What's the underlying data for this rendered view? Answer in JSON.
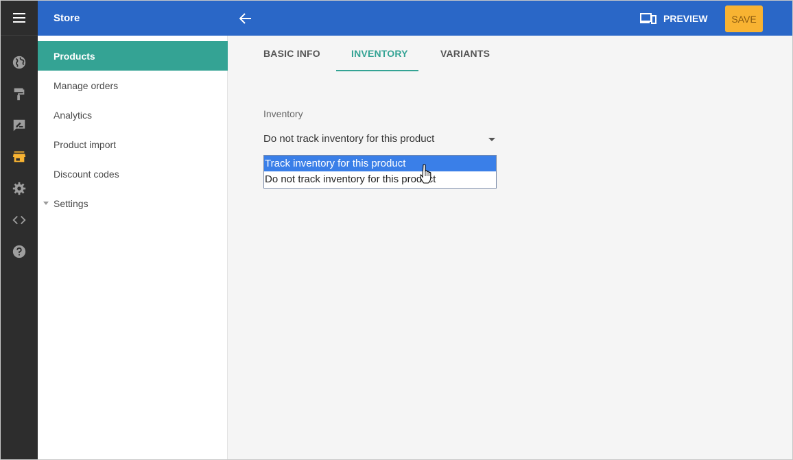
{
  "app": {
    "title": "Store"
  },
  "rail": {
    "icons": [
      "menu-icon",
      "globe-icon",
      "paint-roller-icon",
      "feedback-icon",
      "store-icon",
      "gear-icon",
      "code-icon",
      "help-icon"
    ],
    "active_color": "#f8b332"
  },
  "header": {
    "back_icon": "arrow-left-icon",
    "preview_label": "PREVIEW",
    "save_label": "SAVE"
  },
  "sidebar": {
    "items": [
      {
        "label": "Products",
        "active": true
      },
      {
        "label": "Manage orders"
      },
      {
        "label": "Analytics"
      },
      {
        "label": "Product import"
      },
      {
        "label": "Discount codes"
      },
      {
        "label": "Settings",
        "collapsible": true
      }
    ]
  },
  "tabs": [
    {
      "label": "BASIC INFO"
    },
    {
      "label": "INVENTORY",
      "active": true
    },
    {
      "label": "VARIANTS"
    }
  ],
  "inventory": {
    "label": "Inventory",
    "selected_value": "Do not track inventory for this product",
    "options": [
      "Track inventory for this product",
      "Do not track inventory for this product"
    ],
    "highlighted_option": "Track inventory for this product"
  },
  "colors": {
    "header_bg": "#2a67c7",
    "accent_teal": "#34a394",
    "save_button": "#f8b332",
    "rail_bg": "#2d2d2d"
  }
}
